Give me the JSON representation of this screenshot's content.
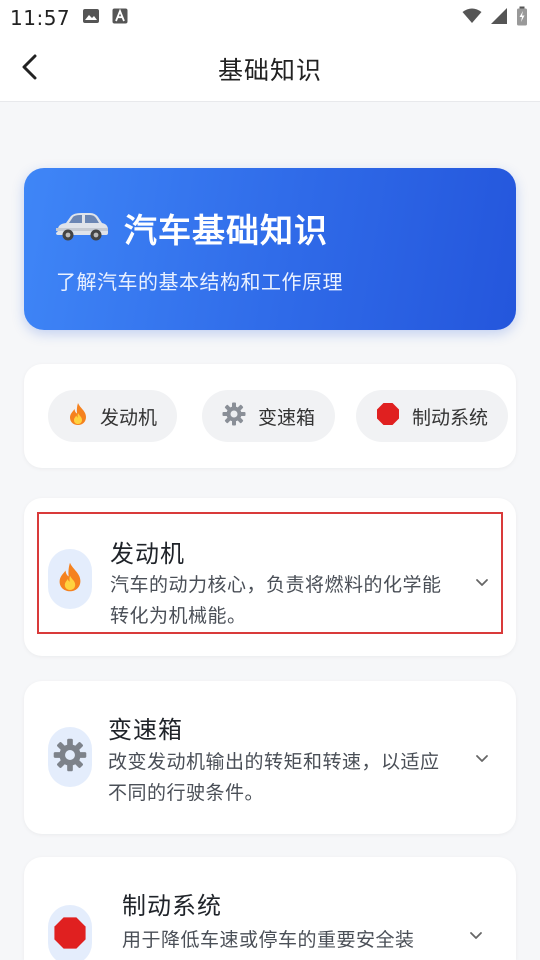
{
  "status_bar": {
    "time": "11:57",
    "icons_left": [
      "image-icon",
      "text-a-icon"
    ],
    "icons_right": [
      "wifi-icon",
      "signal-icon",
      "battery-icon"
    ]
  },
  "nav": {
    "title": "基础知识",
    "back_icon": "chevron-left-icon"
  },
  "hero": {
    "icon": "car-icon",
    "title": "汽车基础知识",
    "subtitle": "了解汽车的基本结构和工作原理",
    "colors": {
      "start": "#3f86f7",
      "end": "#2456dc"
    }
  },
  "chips": [
    {
      "icon": "fire-icon",
      "label": "发动机"
    },
    {
      "icon": "gear-icon",
      "label": "变速箱"
    },
    {
      "icon": "stop-sign-icon",
      "label": "制动系统"
    }
  ],
  "topics": [
    {
      "icon": "fire-icon",
      "title": "发动机",
      "desc_line1": "汽车的动力核心，负责将燃料的化学能",
      "desc_line2": "转化为机械能。",
      "highlighted": true
    },
    {
      "icon": "gear-icon",
      "title": "变速箱",
      "desc_line1": "改变发动机输出的转矩和转速，以适应",
      "desc_line2": "不同的行驶条件。",
      "highlighted": false
    },
    {
      "icon": "stop-sign-icon",
      "title": "制动系统",
      "desc_line1": "用于降低车速或停车的重要安全装",
      "desc_line2": "",
      "highlighted": false
    }
  ],
  "colors": {
    "highlight_border": "#d93a3a",
    "icon_bg": "#e4edfc",
    "page_bg": "#f6f7f9"
  }
}
